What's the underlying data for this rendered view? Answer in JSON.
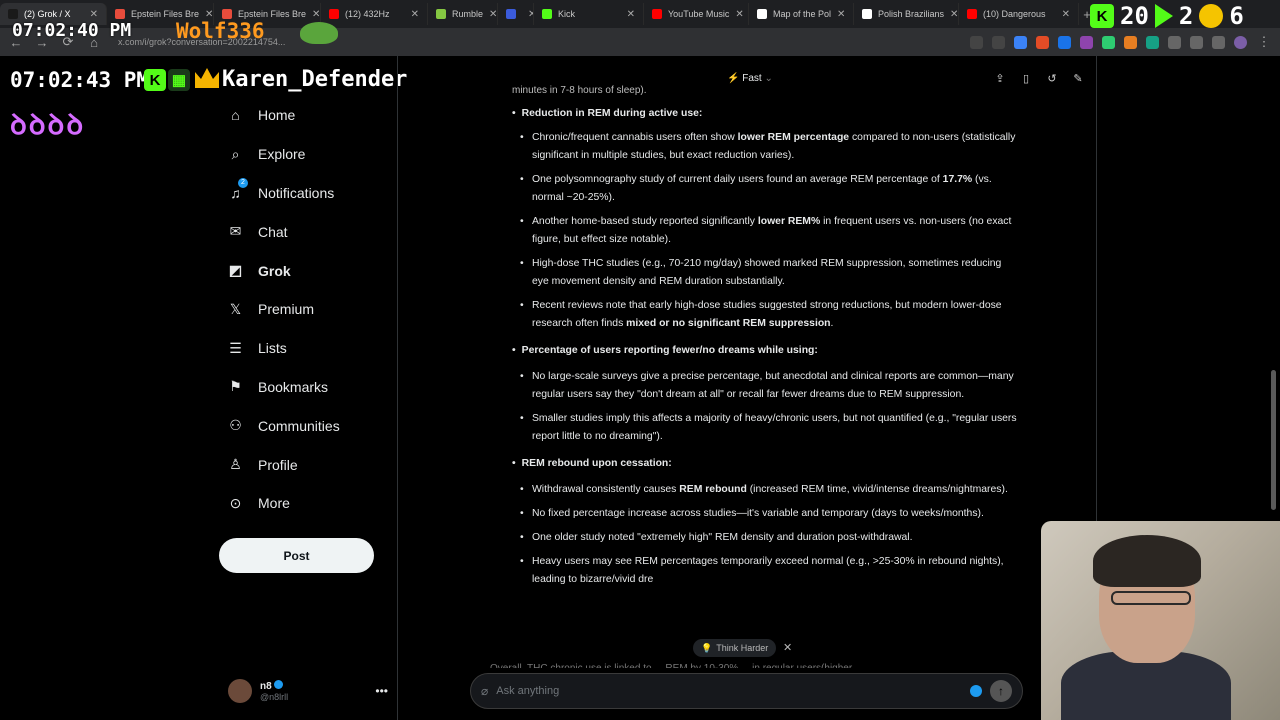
{
  "browser": {
    "tabs": [
      {
        "title": "(2) Grok / X",
        "fav": "#1a1a1a",
        "active": true
      },
      {
        "title": "Epstein Files Bre",
        "fav": "#e74c3c"
      },
      {
        "title": "Epstein Files Bre",
        "fav": "#e74c3c"
      },
      {
        "title": "(12) 432Hz",
        "fav": "#ff0000"
      },
      {
        "title": "Rumble",
        "fav": "#85c742"
      },
      {
        "title": "",
        "fav": "#3b5bdb"
      },
      {
        "title": "Kick",
        "fav": "#53fc18"
      },
      {
        "title": "YouTube Music",
        "fav": "#ff0000"
      },
      {
        "title": "Map of the Pol",
        "fav": "#ffffff"
      },
      {
        "title": "Polish Brazilians",
        "fav": "#ffffff"
      },
      {
        "title": "(10) Dangerous",
        "fav": "#ff0000"
      }
    ],
    "url": "x.com/i/grok?conversation=2002214754..."
  },
  "overlay": {
    "time_top": "07:02:40 PM",
    "wolf_name": "Wolf336",
    "time_main": "07:02:43 PM",
    "karen_name": "Karen_Defender",
    "purple_glyphs": "ꝺꝺꝺꝺ",
    "counter_a": "20",
    "counter_b": "2",
    "counter_c": "6"
  },
  "sidebar": {
    "items": [
      {
        "label": "Home",
        "icon": "home-icon"
      },
      {
        "label": "Explore",
        "icon": "search-icon"
      },
      {
        "label": "Notifications",
        "icon": "bell-icon",
        "badge": "2"
      },
      {
        "label": "Chat",
        "icon": "mail-icon"
      },
      {
        "label": "Grok",
        "icon": "grok-icon",
        "active": true
      },
      {
        "label": "Premium",
        "icon": "x-logo-icon"
      },
      {
        "label": "Lists",
        "icon": "list-icon"
      },
      {
        "label": "Bookmarks",
        "icon": "bookmark-icon"
      },
      {
        "label": "Communities",
        "icon": "people-icon"
      },
      {
        "label": "Profile",
        "icon": "person-icon"
      },
      {
        "label": "More",
        "icon": "more-circle-icon"
      }
    ],
    "post_label": "Post",
    "profile": {
      "name": "n8",
      "handle": "@n8lrll"
    }
  },
  "grok": {
    "mode_label": "Fast",
    "clipped_top": "minutes in 7-8 hours of sleep).",
    "sections": [
      {
        "title": "Reduction in REM during active use:",
        "bullets": [
          [
            {
              "t": "Chronic/frequent cannabis users often show "
            },
            {
              "t": "lower REM percentage",
              "b": true
            },
            {
              "t": " compared to non-users (statistically significant in multiple studies, but exact reduction varies)."
            }
          ],
          [
            {
              "t": "One polysomnography study of current daily users found an average REM percentage of "
            },
            {
              "t": "17.7%",
              "b": true
            },
            {
              "t": " (vs. normal ~20-25%)."
            }
          ],
          [
            {
              "t": "Another home-based study reported significantly "
            },
            {
              "t": "lower REM%",
              "b": true
            },
            {
              "t": " in frequent users vs. non-users (no exact figure, but effect size notable)."
            }
          ],
          [
            {
              "t": "High-dose THC studies (e.g., 70-210 mg/day) showed marked REM suppression, sometimes reducing eye movement density and REM duration substantially."
            }
          ],
          [
            {
              "t": "Recent reviews note that early high-dose studies suggested strong reductions, but modern lower-dose research often finds "
            },
            {
              "t": "mixed or no significant REM suppression",
              "b": true
            },
            {
              "t": "."
            }
          ]
        ]
      },
      {
        "title": "Percentage of users reporting fewer/no dreams while using:",
        "bullets": [
          [
            {
              "t": "No large-scale surveys give a precise percentage, but anecdotal and clinical reports are common—many regular users say they \"don't dream at all\" or recall far fewer dreams due to REM suppression."
            }
          ],
          [
            {
              "t": "Smaller studies imply this affects a majority of heavy/chronic users, but not quantified (e.g., \"regular users report little to no dreaming\")."
            }
          ]
        ]
      },
      {
        "title": "REM rebound upon cessation:",
        "bullets": [
          [
            {
              "t": "Withdrawal consistently causes "
            },
            {
              "t": "REM rebound",
              "b": true
            },
            {
              "t": " (increased REM time, vivid/intense dreams/nightmares)."
            }
          ],
          [
            {
              "t": "No fixed percentage increase across studies—it's variable and temporary (days to weeks/months)."
            }
          ],
          [
            {
              "t": "One older study noted \"extremely high\" REM density and duration post-withdrawal."
            }
          ],
          [
            {
              "t": "Heavy users may see REM percentages temporarily exceed normal (e.g., >25-30% in rebound nights), leading to bizarre/vivid dre"
            }
          ]
        ]
      }
    ],
    "partial_bottom": "Overall, THC chronic use is linked to ... REM by 10-30% ... in regular users(higher...",
    "think_harder_label": "Think Harder",
    "input_placeholder": "Ask anything"
  }
}
